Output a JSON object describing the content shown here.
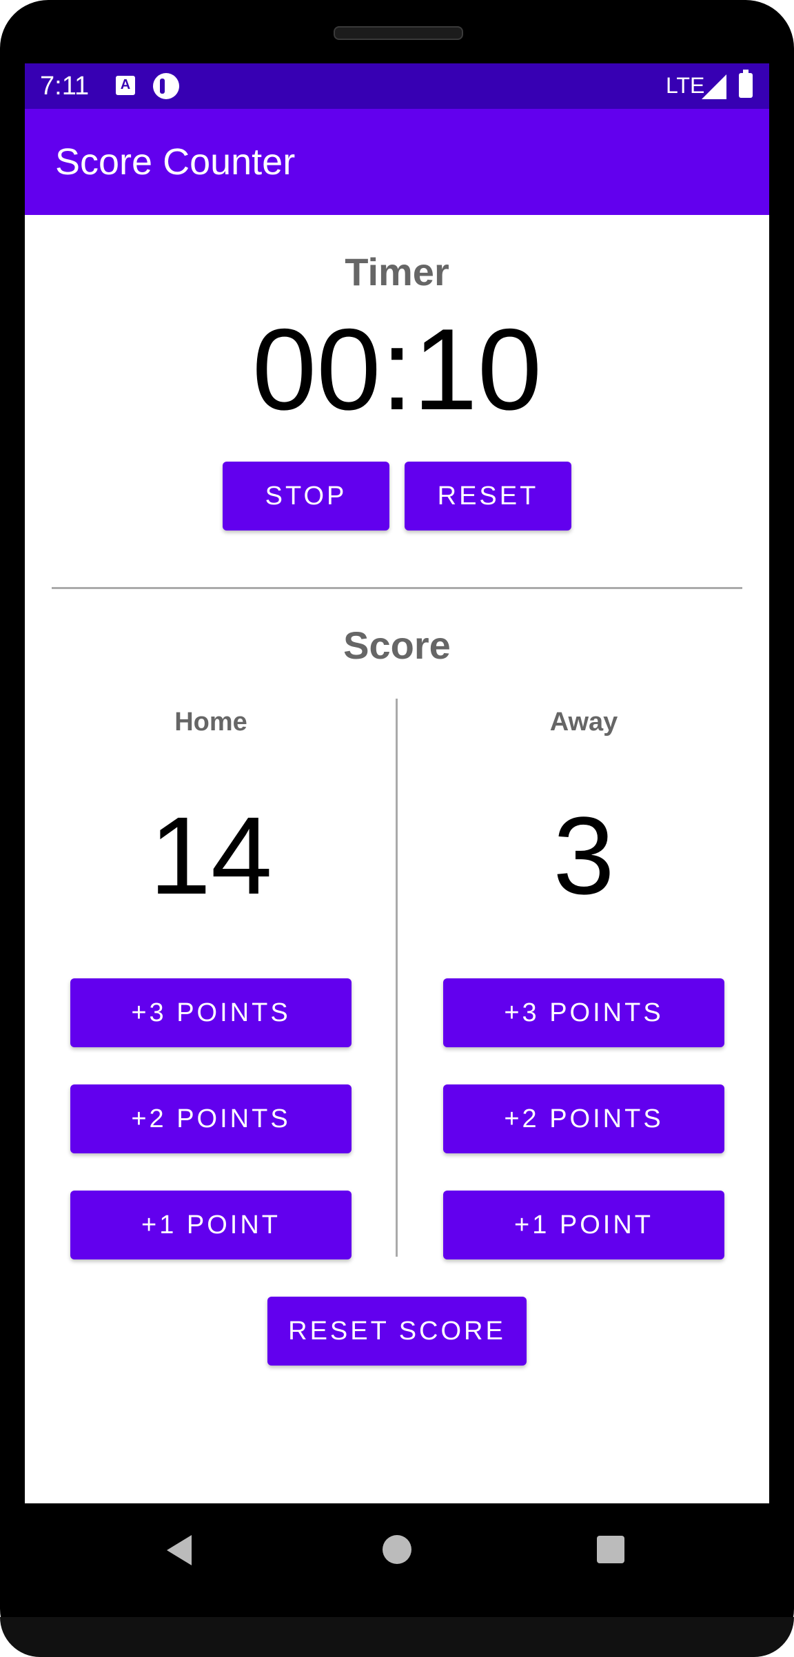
{
  "status_bar": {
    "time": "7:11",
    "network": "LTE",
    "icons": [
      "a-notification-icon",
      "dot-notification-icon",
      "signal-icon",
      "battery-icon"
    ]
  },
  "app_bar": {
    "title": "Score Counter"
  },
  "timer": {
    "title": "Timer",
    "value": "00:10",
    "stop_label": "STOP",
    "reset_label": "RESET"
  },
  "score": {
    "title": "Score",
    "home": {
      "label": "Home",
      "value": "14",
      "plus3_label": "+3 POINTS",
      "plus2_label": "+2 POINTS",
      "plus1_label": "+1 POINT"
    },
    "away": {
      "label": "Away",
      "value": "3",
      "plus3_label": "+3 POINTS",
      "plus2_label": "+2 POINTS",
      "plus1_label": "+1 POINT"
    },
    "reset_label": "RESET SCORE"
  },
  "nav_bar": {
    "icons": [
      "back-icon",
      "home-icon",
      "recents-icon"
    ]
  },
  "colors": {
    "primary": "#6200ee",
    "primary_dark": "#3700b3",
    "title_text": "#666666"
  }
}
